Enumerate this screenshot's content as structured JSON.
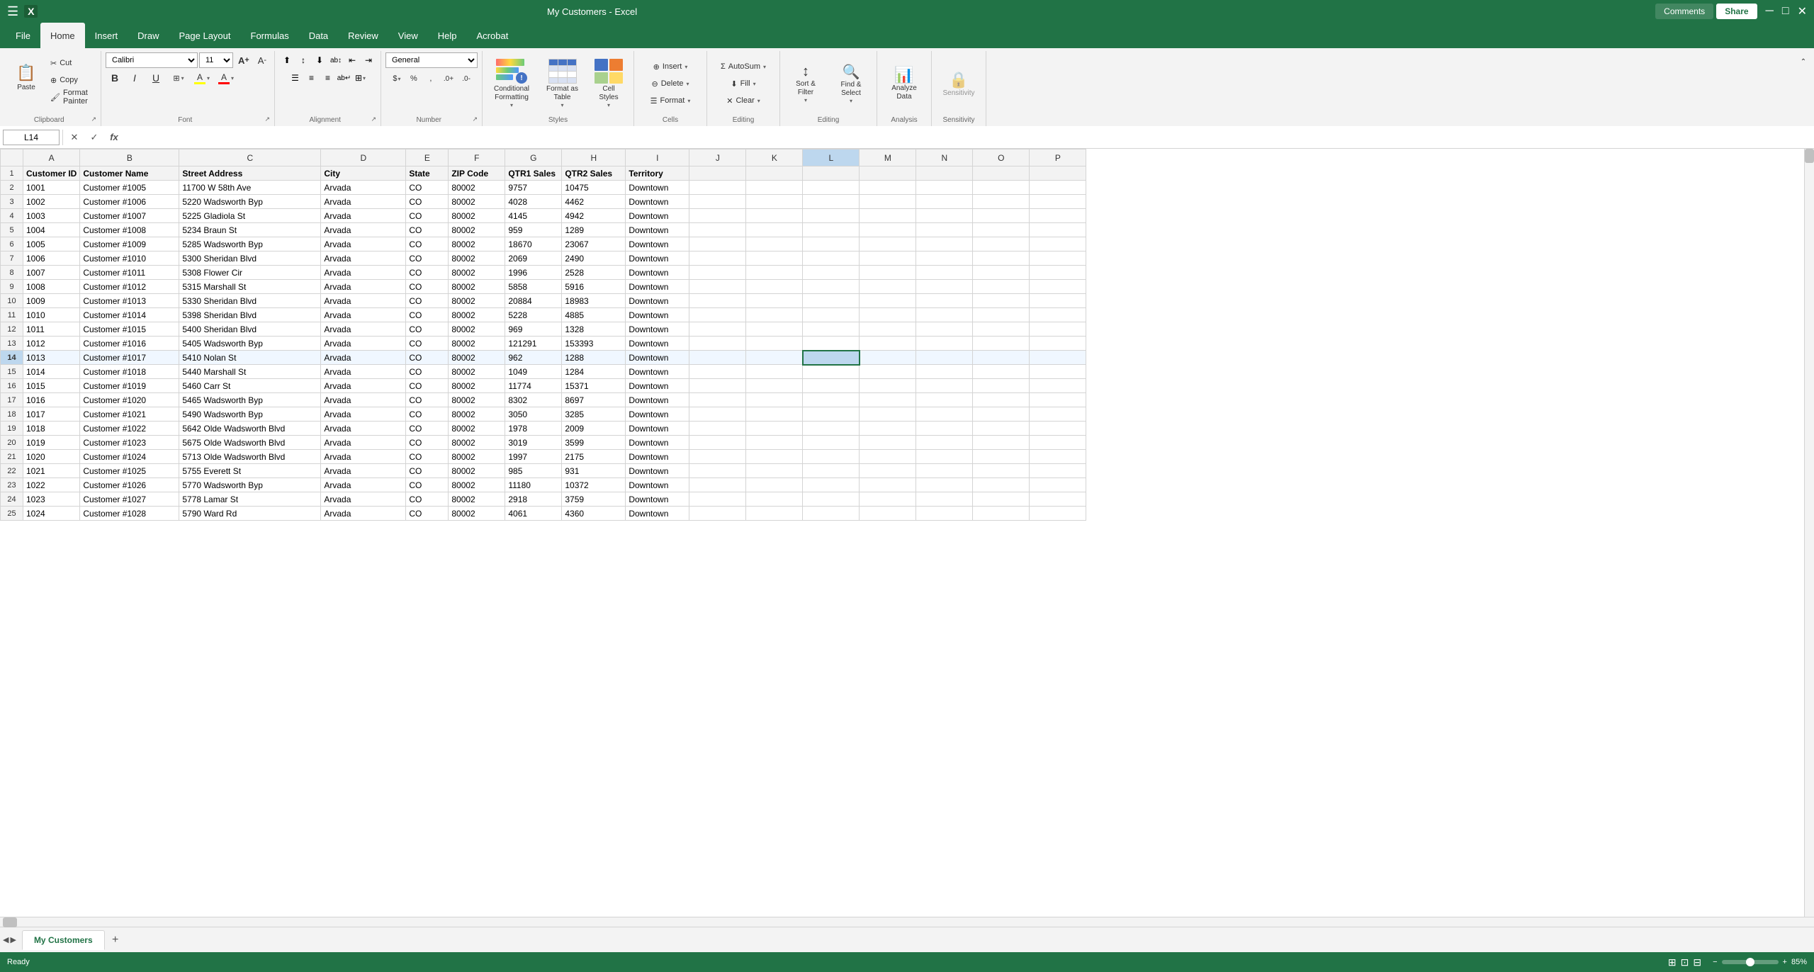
{
  "app": {
    "title": "My Customers - Excel",
    "filename": "My Customers"
  },
  "ribbon": {
    "tabs": [
      "File",
      "Home",
      "Insert",
      "Draw",
      "Page Layout",
      "Formulas",
      "Data",
      "Review",
      "View",
      "Help",
      "Acrobat"
    ],
    "active_tab": "Home",
    "top_right": [
      "Comments",
      "Share"
    ],
    "groups": {
      "clipboard": {
        "label": "Clipboard",
        "paste_label": "Paste",
        "cut_label": "Cut",
        "copy_label": "Copy",
        "format_painter_label": "Format Painter",
        "dialog_launcher": true
      },
      "font": {
        "label": "Font",
        "font_name": "Calibri",
        "font_size": "11",
        "bold_label": "B",
        "italic_label": "I",
        "underline_label": "U",
        "grow_label": "A↑",
        "shrink_label": "A↓",
        "borders_label": "⊞",
        "fill_color_label": "A",
        "font_color_label": "A",
        "dialog_launcher": true
      },
      "alignment": {
        "label": "Alignment",
        "align_top": "⊤",
        "align_middle": "≡",
        "align_bottom": "⊥",
        "align_left": "≡",
        "align_center": "≡",
        "align_right": "≡",
        "wrap_text": "ab↵",
        "merge_center": "⊞",
        "indent_decrease": "←",
        "indent_increase": "→",
        "text_direction": "↕",
        "dialog_launcher": true
      },
      "number": {
        "label": "Number",
        "format": "General",
        "currency": "$",
        "percent": "%",
        "comma": ",",
        "increase_decimal": "+.0",
        "decrease_decimal": "-.0",
        "dialog_launcher": true
      },
      "styles": {
        "label": "Styles",
        "conditional_formatting_label": "Conditional\nFormatting",
        "format_as_table_label": "Format as\nTable",
        "cell_styles_label": "Cell\nStyles"
      },
      "cells": {
        "label": "Cells",
        "insert_label": "Insert",
        "delete_label": "Delete",
        "format_label": "Format"
      },
      "editing": {
        "label": "Editing",
        "autosum_label": "AutoSum",
        "fill_label": "Fill",
        "clear_label": "Clear",
        "sort_filter_label": "Sort &\nFilter",
        "find_select_label": "Find &\nSelect"
      },
      "analysis": {
        "label": "Analysis",
        "analyze_data_label": "Analyze\nData"
      },
      "sensitivity": {
        "label": "Sensitivity",
        "sensitivity_label": "Sensitivity"
      }
    }
  },
  "formula_bar": {
    "cell_ref": "L14",
    "cancel_btn": "✕",
    "confirm_btn": "✓",
    "fx_btn": "fx",
    "formula": ""
  },
  "grid": {
    "columns": [
      "",
      "A",
      "B",
      "C",
      "D",
      "E",
      "F",
      "G",
      "H",
      "I",
      "J",
      "K",
      "L",
      "M",
      "N",
      "O",
      "P"
    ],
    "col_headers": [
      "Customer ID",
      "Customer Name",
      "Street Address",
      "City",
      "State",
      "ZIP Code",
      "QTR1 Sales",
      "QTR2 Sales",
      "Territory"
    ],
    "selected_cell": "L14",
    "rows": [
      [
        "1",
        "Customer ID",
        "Customer Name",
        "Street Address",
        "City",
        "State",
        "ZIP Code",
        "QTR1 Sales",
        "QTR2 Sales",
        "Territory",
        "",
        "",
        "",
        "",
        "",
        "",
        ""
      ],
      [
        "2",
        "1001",
        "Customer #1005",
        "11700 W 58th Ave",
        "Arvada",
        "CO",
        "80002",
        "9757",
        "10475",
        "Downtown",
        "",
        "",
        "",
        "",
        "",
        "",
        ""
      ],
      [
        "3",
        "1002",
        "Customer #1006",
        "5220 Wadsworth Byp",
        "Arvada",
        "CO",
        "80002",
        "4028",
        "4462",
        "Downtown",
        "",
        "",
        "",
        "",
        "",
        "",
        ""
      ],
      [
        "4",
        "1003",
        "Customer #1007",
        "5225 Gladiola St",
        "Arvada",
        "CO",
        "80002",
        "4145",
        "4942",
        "Downtown",
        "",
        "",
        "",
        "",
        "",
        "",
        ""
      ],
      [
        "5",
        "1004",
        "Customer #1008",
        "5234 Braun St",
        "Arvada",
        "CO",
        "80002",
        "959",
        "1289",
        "Downtown",
        "",
        "",
        "",
        "",
        "",
        "",
        ""
      ],
      [
        "6",
        "1005",
        "Customer #1009",
        "5285 Wadsworth Byp",
        "Arvada",
        "CO",
        "80002",
        "18670",
        "23067",
        "Downtown",
        "",
        "",
        "",
        "",
        "",
        "",
        ""
      ],
      [
        "7",
        "1006",
        "Customer #1010",
        "5300 Sheridan Blvd",
        "Arvada",
        "CO",
        "80002",
        "2069",
        "2490",
        "Downtown",
        "",
        "",
        "",
        "",
        "",
        "",
        ""
      ],
      [
        "8",
        "1007",
        "Customer #1011",
        "5308 Flower Cir",
        "Arvada",
        "CO",
        "80002",
        "1996",
        "2528",
        "Downtown",
        "",
        "",
        "",
        "",
        "",
        "",
        ""
      ],
      [
        "9",
        "1008",
        "Customer #1012",
        "5315 Marshall St",
        "Arvada",
        "CO",
        "80002",
        "5858",
        "5916",
        "Downtown",
        "",
        "",
        "",
        "",
        "",
        "",
        ""
      ],
      [
        "10",
        "1009",
        "Customer #1013",
        "5330 Sheridan Blvd",
        "Arvada",
        "CO",
        "80002",
        "20884",
        "18983",
        "Downtown",
        "",
        "",
        "",
        "",
        "",
        "",
        ""
      ],
      [
        "11",
        "1010",
        "Customer #1014",
        "5398 Sheridan Blvd",
        "Arvada",
        "CO",
        "80002",
        "5228",
        "4885",
        "Downtown",
        "",
        "",
        "",
        "",
        "",
        "",
        ""
      ],
      [
        "12",
        "1011",
        "Customer #1015",
        "5400 Sheridan Blvd",
        "Arvada",
        "CO",
        "80002",
        "969",
        "1328",
        "Downtown",
        "",
        "",
        "",
        "",
        "",
        "",
        ""
      ],
      [
        "13",
        "1012",
        "Customer #1016",
        "5405 Wadsworth Byp",
        "Arvada",
        "CO",
        "80002",
        "121291",
        "153393",
        "Downtown",
        "",
        "",
        "",
        "",
        "",
        "",
        ""
      ],
      [
        "14",
        "1013",
        "Customer #1017",
        "5410 Nolan St",
        "Arvada",
        "CO",
        "80002",
        "962",
        "1288",
        "Downtown",
        "",
        "",
        "",
        "",
        "",
        "",
        ""
      ],
      [
        "15",
        "1014",
        "Customer #1018",
        "5440 Marshall St",
        "Arvada",
        "CO",
        "80002",
        "1049",
        "1284",
        "Downtown",
        "",
        "",
        "",
        "",
        "",
        "",
        ""
      ],
      [
        "16",
        "1015",
        "Customer #1019",
        "5460 Carr St",
        "Arvada",
        "CO",
        "80002",
        "11774",
        "15371",
        "Downtown",
        "",
        "",
        "",
        "",
        "",
        "",
        ""
      ],
      [
        "17",
        "1016",
        "Customer #1020",
        "5465 Wadsworth Byp",
        "Arvada",
        "CO",
        "80002",
        "8302",
        "8697",
        "Downtown",
        "",
        "",
        "",
        "",
        "",
        "",
        ""
      ],
      [
        "18",
        "1017",
        "Customer #1021",
        "5490 Wadsworth Byp",
        "Arvada",
        "CO",
        "80002",
        "3050",
        "3285",
        "Downtown",
        "",
        "",
        "",
        "",
        "",
        "",
        ""
      ],
      [
        "19",
        "1018",
        "Customer #1022",
        "5642 Olde Wadsworth Blvd",
        "Arvada",
        "CO",
        "80002",
        "1978",
        "2009",
        "Downtown",
        "",
        "",
        "",
        "",
        "",
        "",
        ""
      ],
      [
        "20",
        "1019",
        "Customer #1023",
        "5675 Olde Wadsworth Blvd",
        "Arvada",
        "CO",
        "80002",
        "3019",
        "3599",
        "Downtown",
        "",
        "",
        "",
        "",
        "",
        "",
        ""
      ],
      [
        "21",
        "1020",
        "Customer #1024",
        "5713 Olde Wadsworth Blvd",
        "Arvada",
        "CO",
        "80002",
        "1997",
        "2175",
        "Downtown",
        "",
        "",
        "",
        "",
        "",
        "",
        ""
      ],
      [
        "22",
        "1021",
        "Customer #1025",
        "5755 Everett St",
        "Arvada",
        "CO",
        "80002",
        "985",
        "931",
        "Downtown",
        "",
        "",
        "",
        "",
        "",
        "",
        ""
      ],
      [
        "23",
        "1022",
        "Customer #1026",
        "5770 Wadsworth Byp",
        "Arvada",
        "CO",
        "80002",
        "11180",
        "10372",
        "Downtown",
        "",
        "",
        "",
        "",
        "",
        "",
        ""
      ],
      [
        "24",
        "1023",
        "Customer #1027",
        "5778 Lamar St",
        "Arvada",
        "CO",
        "80002",
        "2918",
        "3759",
        "Downtown",
        "",
        "",
        "",
        "",
        "",
        "",
        ""
      ],
      [
        "25",
        "1024",
        "Customer #1028",
        "5790 Ward Rd",
        "Arvada",
        "CO",
        "80002",
        "4061",
        "4360",
        "Downtown",
        "",
        "",
        "",
        "",
        "",
        "",
        ""
      ]
    ]
  },
  "sheet_tabs": {
    "tabs": [
      "My Customers"
    ],
    "active": "My Customers",
    "add_btn": "+"
  },
  "status_bar": {
    "ready": "Ready",
    "zoom": "85%",
    "view_normal": "⊞",
    "view_layout": "⊡",
    "view_page_break": "⊟"
  }
}
